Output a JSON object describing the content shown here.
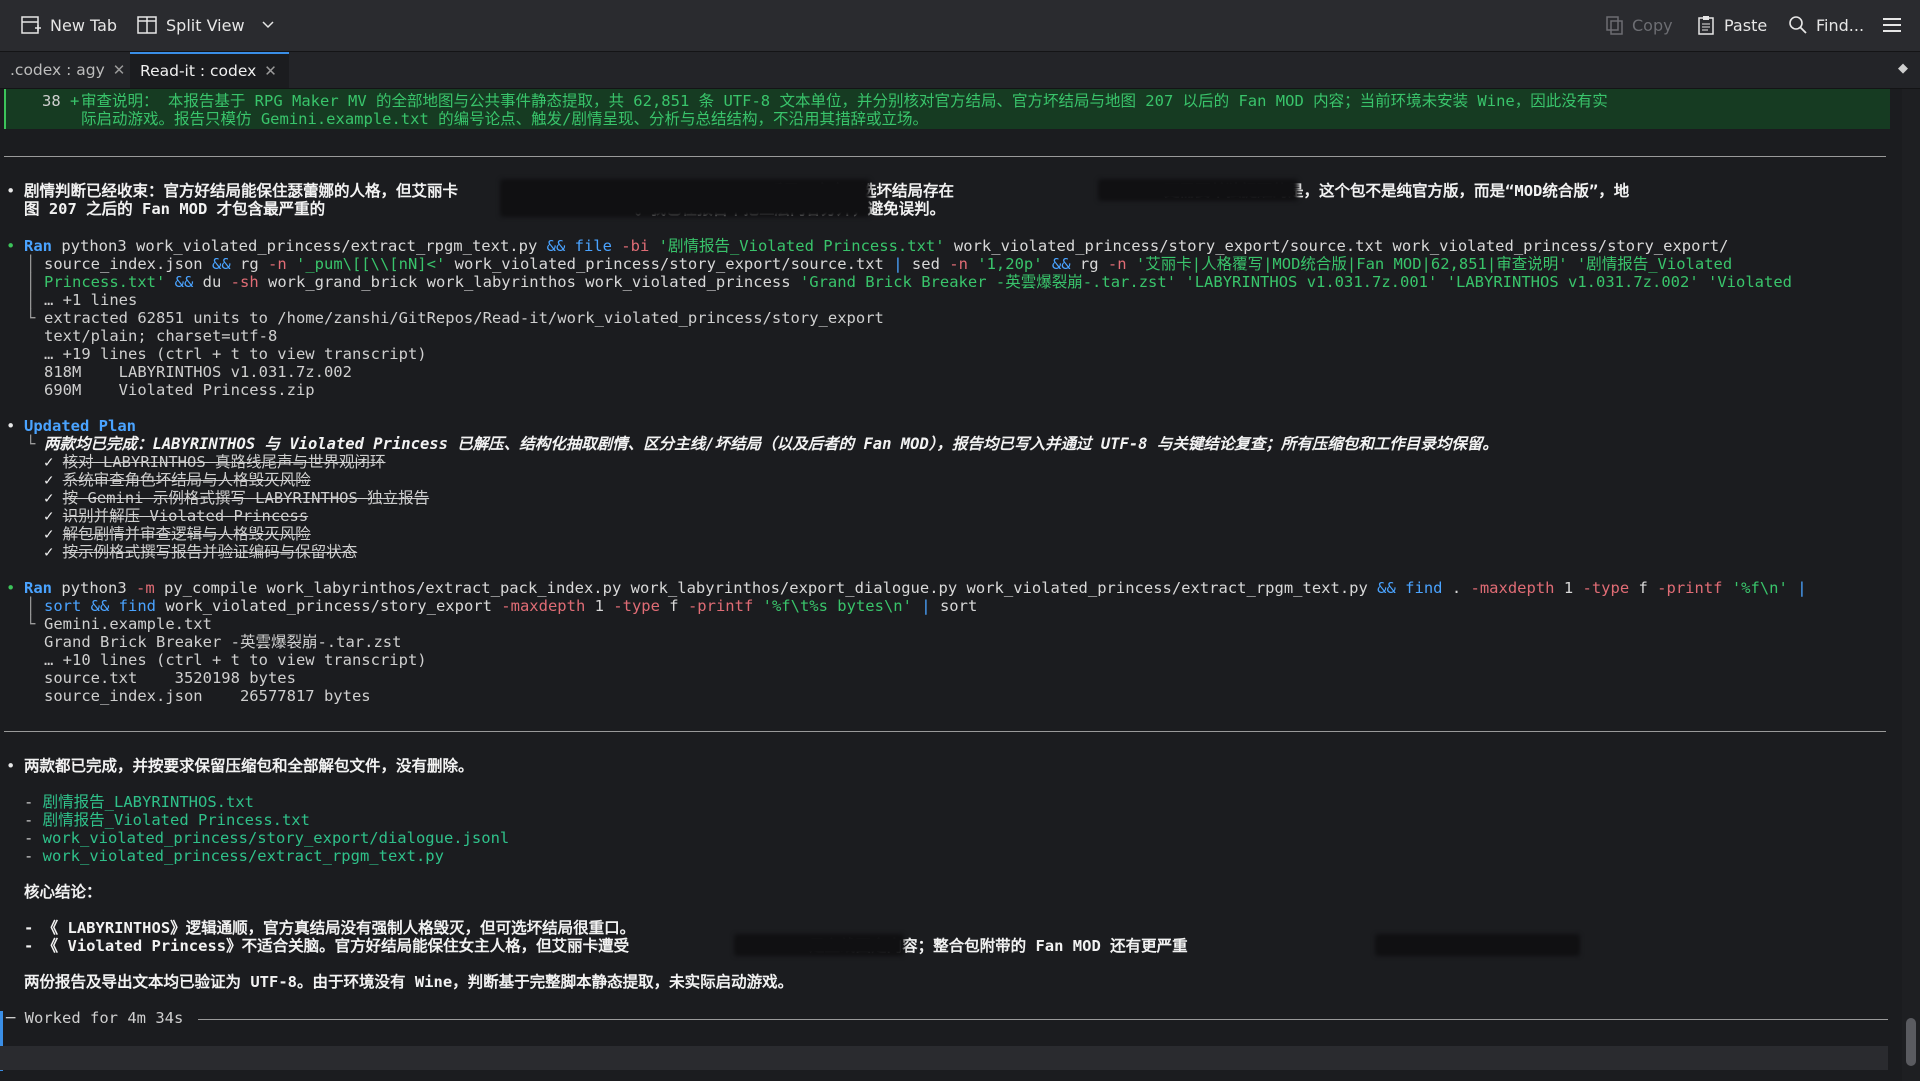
{
  "toolbar": {
    "new_tab": "New Tab",
    "split_view": "Split View",
    "copy": "Copy",
    "paste": "Paste",
    "find": "Find..."
  },
  "tabs": [
    {
      "label": ".codex : agy"
    },
    {
      "label": "Read-it : codex"
    }
  ],
  "diff": {
    "line_no": "38",
    "sign": "+",
    "line1": "审查说明： 本报告基于 RPG Maker MV 的全部地图与公共事件静态提取，共 62,851 条 UTF-8 文本单位，并分别核对官方结局、官方坏结局与地图 207 以后的 Fan MOD 内容；当前环境未安装 Wine，因此没有实",
    "line2": "际启动游戏。报告只模仿 Gemini.example.txt 的编号论点、触发/剧情呈现、分析与总结结构，不沿用其措辞或立场。"
  },
  "msg1": {
    "l1_a": "剧情判断已经收束：官方好结局能保住瑟蕾娜的人格，但艾丽卡",
    "l1_b": "后果；官方可选坏结局存在",
    "l1_c": "更需要单独提醒的是，这个包不是纯官方版，而是“MOD统合版”，地",
    "l2_a": "图 207 之后的 Fan MOD 才包含最严重的",
    "l2_b": "。我已在报告中把三层内容分开，避免误判。"
  },
  "run1": {
    "ran": "Ran",
    "l1": [
      "python3",
      " work_violated_princess/extract_rpgm_text.py ",
      "&&",
      " file ",
      "-bi",
      " '剧情报告_Violated Princess.txt'",
      " work_violated_princess/story_export/source.txt work_violated_princess/story_export/"
    ],
    "l2": [
      "source_index.json ",
      "&&",
      " rg ",
      "-n",
      " '_pum\\[[\\\\[nN]<'",
      " work_violated_princess/story_export/source.txt ",
      "|",
      " sed ",
      "-n",
      " '1,20p'",
      " && ",
      "rg ",
      "-n",
      " '艾丽卡|人格覆写|MOD统合版|Fan MOD|62,851|审查说明'",
      " '剧情报告_Violated"
    ],
    "l3": [
      "Princess.txt'",
      " && ",
      "du ",
      "-sh",
      " work_grand_brick work_labyrinthos work_violated_princess ",
      "'Grand Brick Breaker -英雲爆裂崩-.tar.zst'",
      " ",
      "'LABYRINTHOS v1.031.7z.001'",
      " ",
      "'LABYRINTHOS v1.031.7z.002'",
      " ",
      "'Violated"
    ],
    "more": "… +1 lines",
    "out": [
      "extracted 62851 units to /home/zanshi/GitRepos/Read-it/work_violated_princess/story_export",
      "text/plain; charset=utf-8",
      "… +19 lines (ctrl + t to view transcript)",
      "818M    LABYRINTHOS v1.031.7z.002",
      "690M    Violated Princess.zip"
    ]
  },
  "plan": {
    "title": "Updated Plan",
    "summary": "两款均已完成：LABYRINTHOS 与 Violated Princess 已解压、结构化抽取剧情、区分主线/坏结局（以及后者的 Fan MOD），报告均已写入并通过 UTF-8 与关键结论复查；所有压缩包和工作目录均保留。",
    "items": [
      "核对 LABYRINTHOS 真路线尾声与世界观闭环",
      "系统审查角色坏结局与人格毁灭风险",
      "按 Gemini 示例格式撰写 LABYRINTHOS 独立报告",
      "识别并解压 Violated Princess",
      "解包剧情并审查逻辑与人格毁灭风险",
      "按示例格式撰写报告并验证编码与保留状态"
    ]
  },
  "run2": {
    "ran": "Ran",
    "l1": [
      "python3",
      " ",
      "-m",
      " py_compile work_labyrinthos/extract_pack_index.py work_labyrinthos/export_dialogue.py work_violated_princess/extract_rpgm_text.py ",
      "&&",
      " find ",
      ". ",
      "-maxdepth",
      " 1 ",
      "-type",
      " f ",
      "-printf",
      " ",
      "'%f\\n'",
      " ",
      "|"
    ],
    "l2": [
      "sort ",
      "&&",
      " find ",
      "work_violated_princess/story_export ",
      "-maxdepth",
      " 1 ",
      "-type",
      " f ",
      "-printf",
      " ",
      "'%f\\t%s bytes\\n'",
      " ",
      "|",
      " sort"
    ],
    "out": [
      "Gemini.example.txt",
      "Grand Brick Breaker -英雲爆裂崩-.tar.zst",
      "… +10 lines (ctrl + t to view transcript)",
      "source.txt    3520198 bytes",
      "source_index.json    26577817 bytes"
    ]
  },
  "final": {
    "intro": "两款都已完成，并按要求保留压缩包和全部解包文件，没有删除。",
    "files": [
      "剧情报告_LABYRINTHOS.txt",
      "剧情报告_Violated Princess.txt",
      "work_violated_princess/story_export/dialogue.jsonl",
      "work_violated_princess/extract_rpgm_text.py"
    ],
    "core_title": "核心结论：",
    "c1": "- 《 LABYRINTHOS》逻辑通顺，官方真结局没有强制人格毁灭，但可选坏结局很重口。",
    "c2_a": "- 《 Violated Princess》不适合关脑。官方好结局能保住女主人格，但艾丽卡遭受",
    "c2_b": "是主线固定内容；整合包附带的 Fan MOD 还有更严重",
    "verify": "两份报告及导出文本均已验证为 UTF-8。由于环境没有 Wine，判断基于完整脚本静态提取，未实际启动游戏。",
    "worked": "Worked for 4m 34s"
  }
}
